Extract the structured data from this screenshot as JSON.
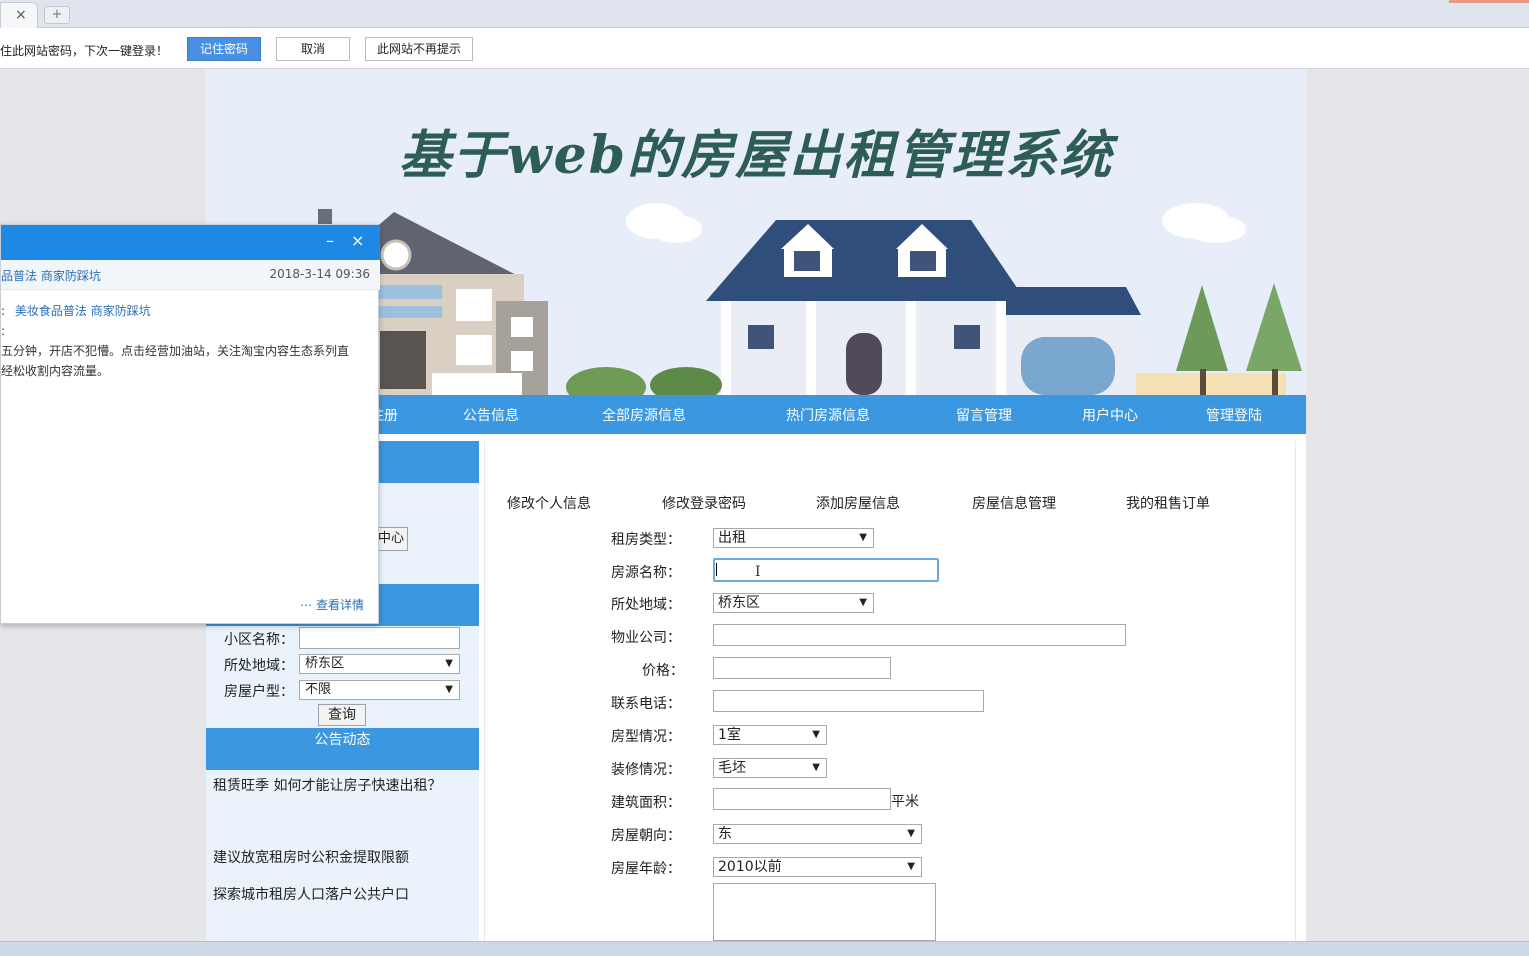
{
  "browser": {
    "tab_close": "×",
    "new_tab": "+"
  },
  "password_bar": {
    "message": "记住此网站密码，下次一键登录！",
    "remember_label": "记住密码",
    "cancel_label": "取消",
    "never_label": "此网站不再提示"
  },
  "banner": {
    "title": "基于web的房屋出租管理系统"
  },
  "nav": {
    "items": [
      "注册",
      "公告信息",
      "全部房源信息",
      "热门房源信息",
      "留言管理",
      "用户中心",
      "管理登陆"
    ]
  },
  "sidebar": {
    "user_center_button": "中心",
    "search": {
      "community_label": "小区名称：",
      "community_value": "",
      "region_label": "所处地域：",
      "region_value": "桥东区",
      "layout_label": "房屋户型：",
      "layout_value": "不限",
      "query_label": "查询"
    },
    "notice_title": "公告动态",
    "notices": [
      "租赁旺季  如何才能让房子快速出租？",
      "建议放宽租房时公积金提取限额",
      "探索城市租房人口落户公共户口"
    ]
  },
  "user_menu": [
    "修改个人信息",
    "修改登录密码",
    "添加房屋信息",
    "房屋信息管理",
    "我的租售订单"
  ],
  "form": {
    "rent_type_label": "租房类型：",
    "rent_type_value": "出租",
    "name_label": "房源名称：",
    "name_value": "",
    "region_label": "所处地域：",
    "region_value": "桥东区",
    "property_label": "物业公司：",
    "property_value": "",
    "price_label": "价格：",
    "price_value": "",
    "phone_label": "联系电话：",
    "phone_value": "",
    "room_label": "房型情况：",
    "room_value": "1室",
    "decor_label": "装修情况：",
    "decor_value": "毛坯",
    "area_label": "建筑面积：",
    "area_value": "",
    "area_unit": "平米",
    "orient_label": "房屋朝向：",
    "orient_value": "东",
    "age_label": "房屋年龄：",
    "age_value": "2010以前"
  },
  "popup": {
    "minimize": "–",
    "close": "×",
    "source": "品普法 商家防踩坑",
    "time": "2018-3-14 09:36",
    "link_prefix": ":",
    "link_text": "美妆食品普法 商家防踩坑",
    "line2": ":",
    "line3": "五分钟，开店不犯懵。点击经营加油站，关注淘宝内容生态系列直",
    "line4": "经松收割内容流量。",
    "more": "查看详情"
  }
}
